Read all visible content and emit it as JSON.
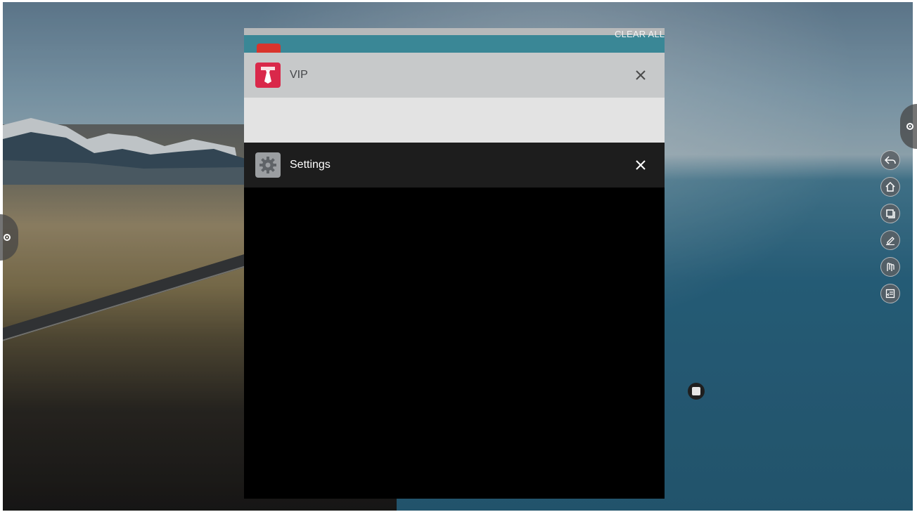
{
  "recents": {
    "clear_all_label": "CLEAR ALL",
    "cards": [
      {
        "title": "VIP",
        "icon": "tie-icon",
        "accent": "#d9284a"
      },
      {
        "title": "Settings",
        "icon": "gear-icon",
        "accent": "#9b9ea1"
      }
    ],
    "close_icon": "close-icon"
  },
  "sidebar_right": {
    "tools": [
      {
        "icon": "back-icon"
      },
      {
        "icon": "home-icon"
      },
      {
        "icon": "recent-apps-icon"
      },
      {
        "icon": "annotate-icon"
      },
      {
        "icon": "touch-tool-icon"
      },
      {
        "icon": "sidebar-panel-icon"
      }
    ]
  },
  "colors": {
    "teal_card": "#3a8796",
    "vip_header": "#c7c9ca",
    "settings_header": "#1d1d1d"
  }
}
